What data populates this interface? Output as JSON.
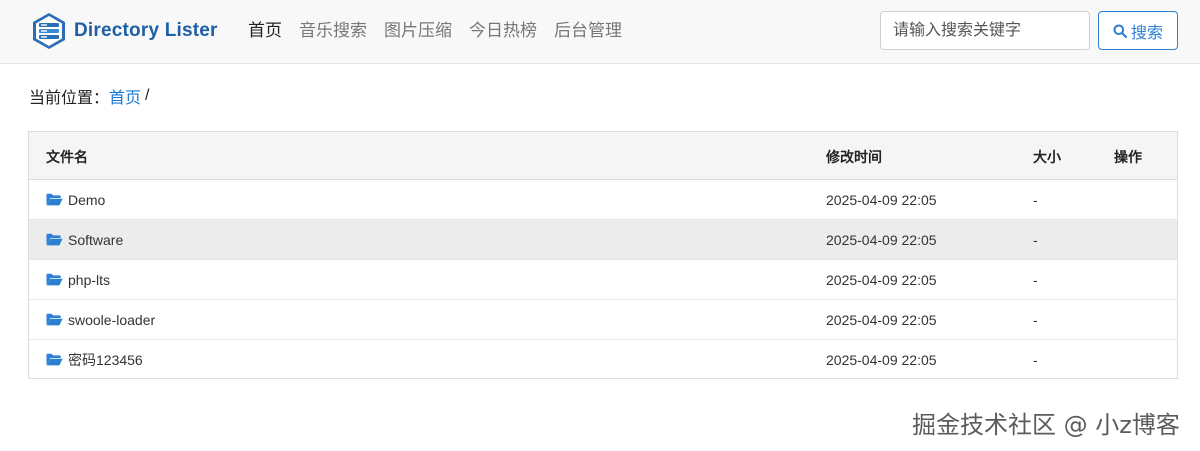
{
  "brand": {
    "name": "Directory Lister",
    "logo_icon": "database-stack-icon"
  },
  "nav": {
    "items": [
      {
        "label": "首页",
        "active": true
      },
      {
        "label": "音乐搜索",
        "active": false
      },
      {
        "label": "图片压缩",
        "active": false
      },
      {
        "label": "今日热榜",
        "active": false
      },
      {
        "label": "后台管理",
        "active": false
      }
    ]
  },
  "search": {
    "placeholder": "请输入搜索关键字",
    "value": "",
    "button_label": "搜索",
    "icon": "search-icon"
  },
  "breadcrumb": {
    "prefix": "当前位置：",
    "home": "首页",
    "separator": "/"
  },
  "table": {
    "headers": {
      "name": "文件名",
      "modified": "修改时间",
      "size": "大小",
      "actions": "操作"
    },
    "rows": [
      {
        "name": "Demo",
        "modified": "2025-04-09 22:05",
        "size": "-",
        "icon": "folder-open-icon"
      },
      {
        "name": "Software",
        "modified": "2025-04-09 22:05",
        "size": "-",
        "icon": "folder-open-icon"
      },
      {
        "name": "php-lts",
        "modified": "2025-04-09 22:05",
        "size": "-",
        "icon": "folder-open-icon"
      },
      {
        "name": "swoole-loader",
        "modified": "2025-04-09 22:05",
        "size": "-",
        "icon": "folder-open-icon"
      },
      {
        "name": "密码123456",
        "modified": "2025-04-09 22:05",
        "size": "-",
        "icon": "folder-open-icon"
      }
    ]
  },
  "watermark": "掘金技术社区 @ 小z博客",
  "colors": {
    "brand": "#1f5fa5",
    "accent": "#2e7fd6",
    "link": "#1a78d6",
    "folder": "#2b80d3"
  }
}
